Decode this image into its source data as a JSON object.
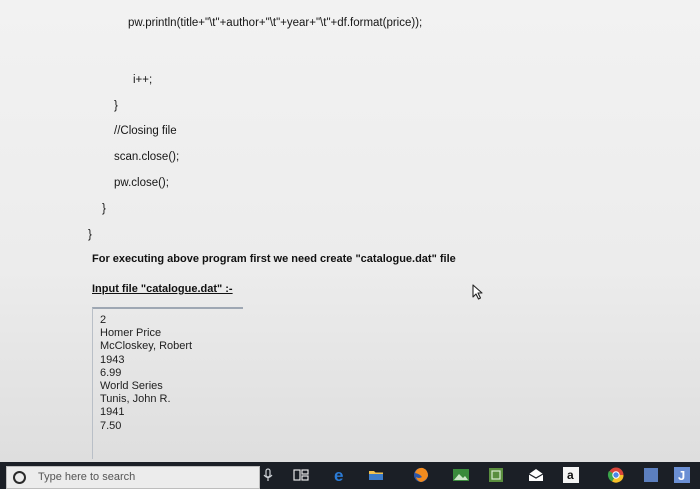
{
  "document": {
    "code_lines": [
      "pw.println(title+\"\\t\"+author+\"\\t\"+year+\"\\t\"+df.format(price));",
      "i++;",
      "}",
      "//Closing file",
      "scan.close();",
      "pw.close();",
      "}",
      "}"
    ],
    "instruction": "For executing above program first we need create \"catalogue.dat\" file",
    "input_heading": "Input file \"catalogue.dat\" :-",
    "file_contents": [
      "2",
      "Homer Price",
      "McCloskey, Robert",
      "1943",
      "6.99",
      "World Series",
      "Tunis, John R.",
      "1941",
      "7.50"
    ]
  },
  "taskbar": {
    "search_placeholder": "Type here to search",
    "icons": [
      "cortana-icon",
      "mic-icon",
      "task-view-icon",
      "edge-icon",
      "file-explorer-icon",
      "firefox-icon",
      "photos-icon",
      "office-icon",
      "mail-icon",
      "amazon-icon",
      "chrome-icon",
      "app-icon",
      "app-j-icon"
    ],
    "amazon_letter": "a",
    "j_letter": "J",
    "colors": {
      "taskbar_bg": "#1b1f26",
      "edge": "#2b7bd6",
      "accent_green": "#3a8a3c"
    }
  }
}
